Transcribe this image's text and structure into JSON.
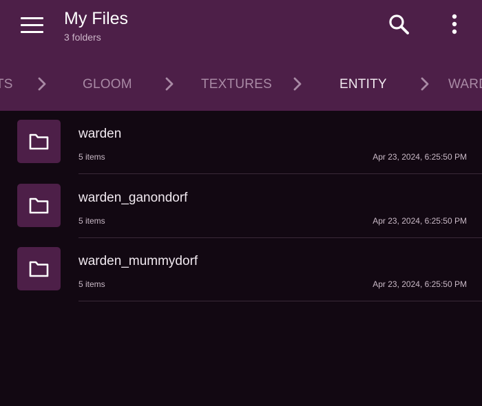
{
  "toolbar": {
    "title": "My Files",
    "subtitle": "3 folders",
    "menu_icon": "hamburger-menu-icon",
    "search_icon": "search-icon",
    "more_icon": "more-vertical-icon"
  },
  "breadcrumb": {
    "items": [
      {
        "label": "TS",
        "active": false
      },
      {
        "label": "GLOOM",
        "active": false
      },
      {
        "label": "TEXTURES",
        "active": false
      },
      {
        "label": "ENTITY",
        "active": true
      },
      {
        "label": "WARDEN",
        "active": false
      }
    ],
    "separator_icon": "chevron-right-icon"
  },
  "files": [
    {
      "name": "warden",
      "count": "5 items",
      "modified": "Apr 23, 2024, 6:25:50 PM",
      "icon": "folder-icon"
    },
    {
      "name": "warden_ganondorf",
      "count": "5 items",
      "modified": "Apr 23, 2024, 6:25:50 PM",
      "icon": "folder-icon"
    },
    {
      "name": "warden_mummydorf",
      "count": "5 items",
      "modified": "Apr 23, 2024, 6:25:50 PM",
      "icon": "folder-icon"
    }
  ],
  "colors": {
    "toolbar_bg": "#4d1f48",
    "page_bg": "#120812",
    "crumb_inactive": "#a98aa5",
    "crumb_active": "#f2eaf1"
  }
}
